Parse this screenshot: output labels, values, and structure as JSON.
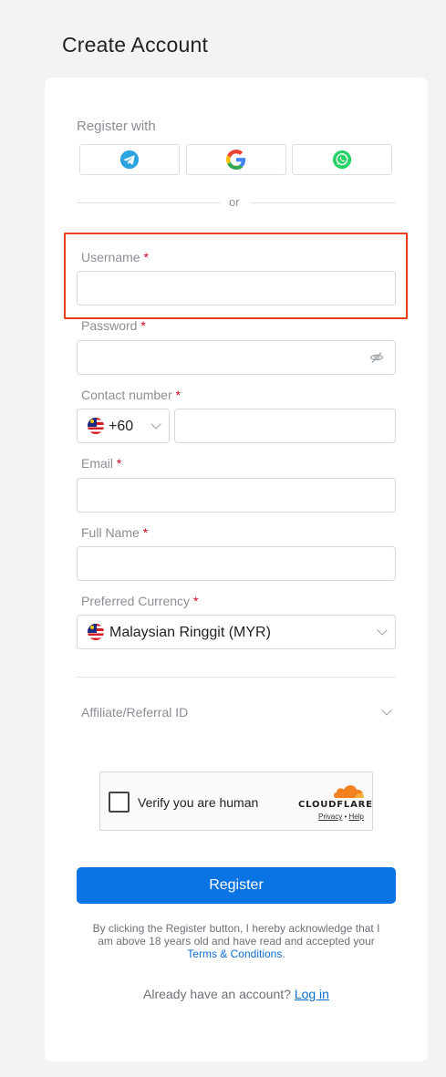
{
  "page": {
    "title": "Create Account"
  },
  "social": {
    "heading": "Register with",
    "providers": [
      "telegram-icon",
      "google-icon",
      "whatsapp-icon"
    ],
    "divider": "or"
  },
  "form": {
    "username": {
      "label": "Username",
      "required_mark": "*",
      "value": "",
      "placeholder": ""
    },
    "password": {
      "label": "Password",
      "required_mark": "*",
      "value": "",
      "placeholder": ""
    },
    "contact": {
      "label": "Contact number",
      "required_mark": "*",
      "country_code": "+60",
      "value": ""
    },
    "email": {
      "label": "Email",
      "required_mark": "*",
      "value": ""
    },
    "full_name": {
      "label": "Full Name",
      "required_mark": "*",
      "value": ""
    },
    "currency": {
      "label": "Preferred Currency",
      "required_mark": "*",
      "selected": "Malaysian Ringgit (MYR)"
    },
    "affiliate": {
      "label": "Affiliate/Referral ID"
    }
  },
  "captcha": {
    "label": "Verify you are human",
    "brand": "CLOUDFLARE",
    "privacy": "Privacy",
    "separator": "•",
    "help": "Help"
  },
  "actions": {
    "register": "Register"
  },
  "disclaimer": {
    "text": "By clicking the Register button, I hereby acknowledge that I am above 18 years old and have read and accepted your",
    "link": "Terms & Conditions",
    "end": "."
  },
  "login": {
    "prompt": "Already have an account?",
    "link": "Log in"
  },
  "colors": {
    "primary": "#0a74e5",
    "required": "#d0021b",
    "highlight": "#e8401c",
    "telegram": "#2aa3de",
    "whatsapp": "#25d366",
    "cloudflare": "#f48120"
  }
}
